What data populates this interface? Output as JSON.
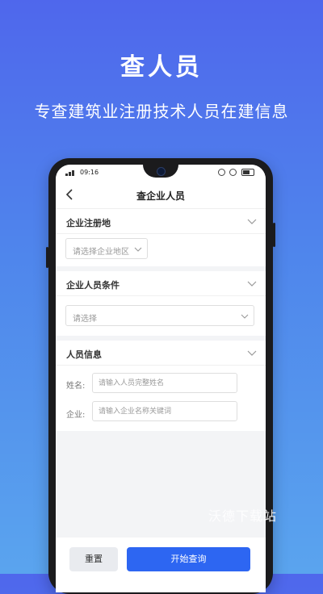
{
  "hero": {
    "title": "查人员",
    "subtitle": "专查建筑业注册技术人员在建信息"
  },
  "statusbar": {
    "time": "09:16"
  },
  "nav": {
    "title": "查企业人员"
  },
  "sections": {
    "region": {
      "title": "企业注册地",
      "select_placeholder": "请选择企业地区"
    },
    "conditions": {
      "title": "企业人员条件",
      "select_placeholder": "请选择"
    },
    "person": {
      "title": "人员信息",
      "name_label": "姓名:",
      "name_placeholder": "请输入人员完整姓名",
      "company_label": "企业:",
      "company_placeholder": "请输入企业名称关键词"
    }
  },
  "buttons": {
    "reset": "重置",
    "query": "开始查询"
  },
  "watermark": "沃德下载站",
  "colors": {
    "primary": "#2d66f2",
    "background_gradient_top": "#4f67ec",
    "background_gradient_bottom": "#5aa4ee"
  }
}
